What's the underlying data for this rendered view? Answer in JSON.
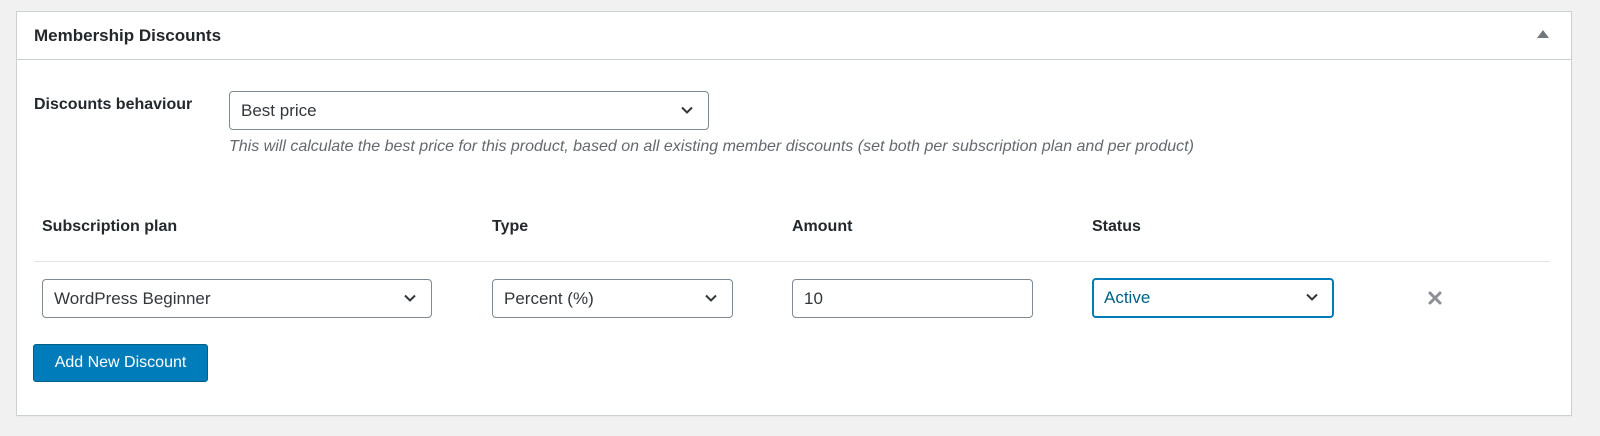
{
  "panel": {
    "title": "Membership Discounts"
  },
  "behaviour": {
    "label": "Discounts behaviour",
    "selected": "Best price",
    "description": "This will calculate the best price for this product, based on all existing member discounts (set both per subscription plan and per product)"
  },
  "table": {
    "headers": {
      "plan": "Subscription plan",
      "type": "Type",
      "amount": "Amount",
      "status": "Status"
    },
    "rows": [
      {
        "plan": "WordPress Beginner",
        "type": "Percent (%)",
        "amount": "10",
        "status": "Active"
      }
    ]
  },
  "actions": {
    "add_label": "Add New Discount"
  },
  "icons": {
    "collapse": "triangle-up-icon",
    "dropdown": "chevron-down-icon",
    "remove": "close-icon"
  },
  "colors": {
    "primary": "#007cba",
    "focus_text": "#016087",
    "border": "#ccd0d4"
  }
}
